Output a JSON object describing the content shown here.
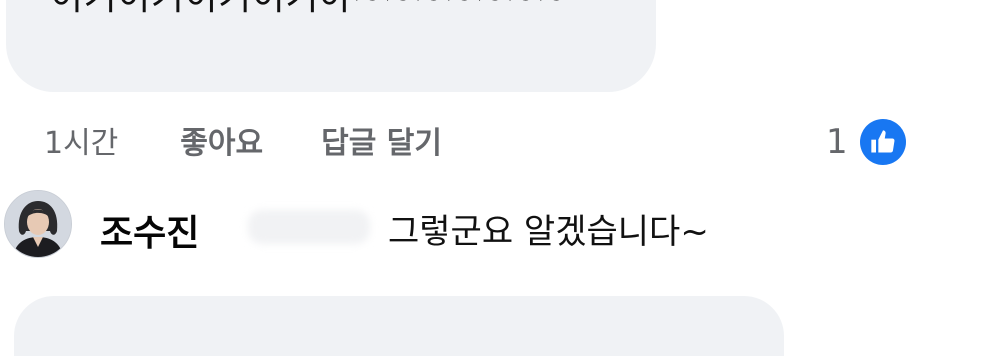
{
  "comment": {
    "text": "이기이기이기이기야~~~~~~~",
    "time": "1시간",
    "like_label": "좋아요",
    "reply_label": "답글 달기",
    "reaction_count": "1",
    "reaction_icon": "thumbs-up-icon"
  },
  "reply": {
    "author": "조수진",
    "text": "그렇군요 알겠습니다~",
    "avatar_icon": "profile-photo"
  },
  "colors": {
    "bubble_bg": "#f0f2f5",
    "meta_text": "#65676b",
    "like_blue": "#1877f2"
  }
}
